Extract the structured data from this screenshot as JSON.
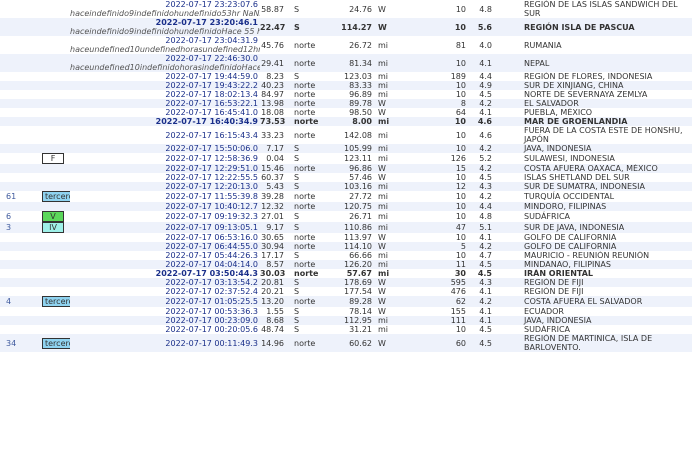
{
  "rows": [
    {
      "felt": "",
      "intensity": "",
      "time": "2022-07-17 23:23:07.6",
      "sub": "haceindefinido9indefinidohundefinido53hr NaNmin ago",
      "dist": "58.87",
      "dir": "S",
      "dist2": "24.76",
      "unit": "W",
      "depth": "10",
      "mag": "4.8",
      "region": "REGIÓN DE LAS ISLAS SANDWICH DEL SUR",
      "alt": false,
      "bold": false
    },
    {
      "felt": "",
      "intensity": "",
      "time": "2022-07-17 23:20:46.1",
      "sub": "haceindefinido9indefinidohundefinidoHace 55 horas NaNmin",
      "dist": "22.47",
      "dir": "S",
      "dist2": "114.27",
      "unit": "W",
      "depth": "10",
      "mag": "5.6",
      "region": "REGIÓN ISLA DE PASCUA",
      "alt": true,
      "bold": true
    },
    {
      "felt": "",
      "intensity": "",
      "time": "2022-07-17 23:04:31.9",
      "sub": "haceundefined10undefinedhorasundefined12hr NaNmin ago",
      "dist": "45.76",
      "dir": "norte",
      "dist2": "26.72",
      "unit": "mi",
      "depth": "81",
      "mag": "4.0",
      "region": "RUMANIA",
      "alt": false,
      "bold": false
    },
    {
      "felt": "",
      "intensity": "",
      "time": "2022-07-17 22:46:30.0",
      "sub": "haceundefined10indefinidohorasindefinidoHace 30hr NaNmin",
      "dist": "29.41",
      "dir": "norte",
      "dist2": "81.34",
      "unit": "mi",
      "depth": "10",
      "mag": "4.1",
      "region": "NEPAL",
      "alt": true,
      "bold": false
    },
    {
      "felt": "",
      "intensity": "",
      "time": "2022-07-17 19:44:59.0",
      "sub": "",
      "dist": "8.23",
      "dir": "S",
      "dist2": "123.03",
      "unit": "mi",
      "depth": "189",
      "mag": "4.4",
      "region": "REGIÓN DE FLORES, INDONESIA",
      "alt": false,
      "bold": false
    },
    {
      "felt": "",
      "intensity": "",
      "time": "2022-07-17 19:43:22.2",
      "sub": "",
      "dist": "40.23",
      "dir": "norte",
      "dist2": "83.33",
      "unit": "mi",
      "depth": "10",
      "mag": "4.9",
      "region": "SUR DE XINJIANG, CHINA",
      "alt": true,
      "bold": false
    },
    {
      "felt": "",
      "intensity": "",
      "time": "2022-07-17 18:02:13.4",
      "sub": "",
      "dist": "84.97",
      "dir": "norte",
      "dist2": "96.89",
      "unit": "mi",
      "depth": "10",
      "mag": "4.5",
      "region": "NORTE DE SEVERNAYA ZEMLYA",
      "alt": false,
      "bold": false
    },
    {
      "felt": "",
      "intensity": "",
      "time": "2022-07-17 16:53:22.1",
      "sub": "",
      "dist": "13.98",
      "dir": "norte",
      "dist2": "89.78",
      "unit": "W",
      "depth": "8",
      "mag": "4.2",
      "region": "EL SALVADOR",
      "alt": true,
      "bold": false
    },
    {
      "felt": "",
      "intensity": "",
      "time": "2022-07-17 16:45:41.0",
      "sub": "",
      "dist": "18.08",
      "dir": "norte",
      "dist2": "98.50",
      "unit": "W",
      "depth": "64",
      "mag": "4.1",
      "region": "PUEBLA, MÉXICO",
      "alt": false,
      "bold": false
    },
    {
      "felt": "",
      "intensity": "",
      "time": "2022-07-17 16:40:34.9",
      "sub": "",
      "dist": "73.53",
      "dir": "norte",
      "dist2": "8.00",
      "unit": "mi",
      "depth": "10",
      "mag": "4.6",
      "region": "MAR DE GROENLANDIA",
      "alt": true,
      "bold": true
    },
    {
      "felt": "",
      "intensity": "",
      "time": "2022-07-17 16:15:43.4",
      "sub": "",
      "dist": "33.23",
      "dir": "norte",
      "dist2": "142.08",
      "unit": "mi",
      "depth": "10",
      "mag": "4.6",
      "region": "FUERA DE LA COSTA ESTE DE HONSHU, JAPÓN",
      "alt": false,
      "bold": false
    },
    {
      "felt": "",
      "intensity": "",
      "time": "2022-07-17 15:50:06.0",
      "sub": "",
      "dist": "7.17",
      "dir": "S",
      "dist2": "105.99",
      "unit": "mi",
      "depth": "10",
      "mag": "4.2",
      "region": "JAVA, INDONESIA",
      "alt": true,
      "bold": false
    },
    {
      "felt": "",
      "intensity": "F",
      "time": "2022-07-17 12:58:36.9",
      "sub": "",
      "dist": "0.04",
      "dir": "S",
      "dist2": "123.11",
      "unit": "mi",
      "depth": "126",
      "mag": "5.2",
      "region": "SULAWESI, INDONESIA",
      "alt": false,
      "bold": false
    },
    {
      "felt": "",
      "intensity": "",
      "time": "2022-07-17 12:29:51.0",
      "sub": "",
      "dist": "15.46",
      "dir": "norte",
      "dist2": "96.86",
      "unit": "W",
      "depth": "15",
      "mag": "4.2",
      "region": "COSTA AFUERA OAXACA, MÉXICO",
      "alt": true,
      "bold": false
    },
    {
      "felt": "",
      "intensity": "",
      "time": "2022-07-17 12:22:55.5",
      "sub": "",
      "dist": "60.37",
      "dir": "S",
      "dist2": "57.46",
      "unit": "W",
      "depth": "10",
      "mag": "4.5",
      "region": "ISLAS SHETLAND DEL SUR",
      "alt": false,
      "bold": false
    },
    {
      "felt": "",
      "intensity": "",
      "time": "2022-07-17 12:20:13.0",
      "sub": "",
      "dist": "5.43",
      "dir": "S",
      "dist2": "103.16",
      "unit": "mi",
      "depth": "12",
      "mag": "4.3",
      "region": "SUR DE SUMATRA, INDONESIA",
      "alt": true,
      "bold": false
    },
    {
      "felt": "61",
      "intensity": "tercero",
      "time": "2022-07-17 11:55:39.8",
      "sub": "",
      "dist": "39.28",
      "dir": "norte",
      "dist2": "27.72",
      "unit": "mi",
      "depth": "10",
      "mag": "4.2",
      "region": "TURQUÍA OCCIDENTAL",
      "alt": false,
      "bold": false
    },
    {
      "felt": "",
      "intensity": "",
      "time": "2022-07-17 10:40:12.7",
      "sub": "",
      "dist": "12.32",
      "dir": "norte",
      "dist2": "120.75",
      "unit": "mi",
      "depth": "10",
      "mag": "4.4",
      "region": "MINDORO, FILIPINAS",
      "alt": true,
      "bold": false
    },
    {
      "felt": "6",
      "intensity": "V",
      "time": "2022-07-17 09:19:32.3",
      "sub": "",
      "dist": "27.01",
      "dir": "S",
      "dist2": "26.71",
      "unit": "mi",
      "depth": "10",
      "mag": "4.8",
      "region": "SUDÁFRICA",
      "alt": false,
      "bold": false
    },
    {
      "felt": "3",
      "intensity": "IV",
      "time": "2022-07-17 09:13:05.1",
      "sub": "",
      "dist": "9.17",
      "dir": "S",
      "dist2": "110.86",
      "unit": "mi",
      "depth": "47",
      "mag": "5.1",
      "region": "SUR DE JAVA, INDONESIA",
      "alt": true,
      "bold": false
    },
    {
      "felt": "",
      "intensity": "",
      "time": "2022-07-17 06:53:16.0",
      "sub": "",
      "dist": "30.65",
      "dir": "norte",
      "dist2": "113.97",
      "unit": "W",
      "depth": "10",
      "mag": "4.1",
      "region": "GOLFO DE CALIFORNIA",
      "alt": false,
      "bold": false
    },
    {
      "felt": "",
      "intensity": "",
      "time": "2022-07-17 06:44:55.0",
      "sub": "",
      "dist": "30.94",
      "dir": "norte",
      "dist2": "114.10",
      "unit": "W",
      "depth": "5",
      "mag": "4.2",
      "region": "GOLFO DE CALIFORNIA",
      "alt": true,
      "bold": false
    },
    {
      "felt": "",
      "intensity": "",
      "time": "2022-07-17 05:44:26.3",
      "sub": "",
      "dist": "17.17",
      "dir": "S",
      "dist2": "66.66",
      "unit": "mi",
      "depth": "10",
      "mag": "4.7",
      "region": "MAURICIO - REUNIÓN REUNIÓN",
      "alt": false,
      "bold": false
    },
    {
      "felt": "",
      "intensity": "",
      "time": "2022-07-17 04:04:14.0",
      "sub": "",
      "dist": "8.57",
      "dir": "norte",
      "dist2": "126.20",
      "unit": "mi",
      "depth": "11",
      "mag": "4.5",
      "region": "MINDANAO, FILIPINAS",
      "alt": true,
      "bold": false
    },
    {
      "felt": "",
      "intensity": "",
      "time": "2022-07-17 03:50:44.3",
      "sub": "",
      "dist": "30.03",
      "dir": "norte",
      "dist2": "57.67",
      "unit": "mi",
      "depth": "30",
      "mag": "4.5",
      "region": "IRÁN ORIENTAL",
      "alt": false,
      "bold": true
    },
    {
      "felt": "",
      "intensity": "",
      "time": "2022-07-17 03:13:54.2",
      "sub": "",
      "dist": "20.81",
      "dir": "S",
      "dist2": "178.69",
      "unit": "W",
      "depth": "595",
      "mag": "4.3",
      "region": "REGIÓN DE FIJI",
      "alt": true,
      "bold": false
    },
    {
      "felt": "",
      "intensity": "",
      "time": "2022-07-17 02:37:52.4",
      "sub": "",
      "dist": "20.21",
      "dir": "S",
      "dist2": "177.54",
      "unit": "W",
      "depth": "476",
      "mag": "4.1",
      "region": "REGIÓN DE FIJI",
      "alt": false,
      "bold": false
    },
    {
      "felt": "4",
      "intensity": "tercero",
      "time": "2022-07-17 01:05:25.5",
      "sub": "",
      "dist": "13.20",
      "dir": "norte",
      "dist2": "89.28",
      "unit": "W",
      "depth": "62",
      "mag": "4.2",
      "region": "COSTA AFUERA EL SALVADOR",
      "alt": true,
      "bold": false
    },
    {
      "felt": "",
      "intensity": "",
      "time": "2022-07-17 00:53:36.3",
      "sub": "",
      "dist": "1.55",
      "dir": "S",
      "dist2": "78.14",
      "unit": "W",
      "depth": "155",
      "mag": "4.1",
      "region": "ECUADOR",
      "alt": false,
      "bold": false
    },
    {
      "felt": "",
      "intensity": "",
      "time": "2022-07-17 00:23:09.0",
      "sub": "",
      "dist": "8.68",
      "dir": "S",
      "dist2": "112.95",
      "unit": "mi",
      "depth": "111",
      "mag": "4.1",
      "region": "JAVA, INDONESIA",
      "alt": true,
      "bold": false
    },
    {
      "felt": "",
      "intensity": "",
      "time": "2022-07-17 00:20:05.6",
      "sub": "",
      "dist": "48.74",
      "dir": "S",
      "dist2": "31.21",
      "unit": "mi",
      "depth": "10",
      "mag": "4.5",
      "region": "SUDÁFRICA",
      "alt": false,
      "bold": false
    },
    {
      "felt": "34",
      "intensity": "tercero",
      "time": "2022-07-17 00:11:49.3",
      "sub": "",
      "dist": "14.96",
      "dir": "norte",
      "dist2": "60.62",
      "unit": "W",
      "depth": "60",
      "mag": "4.5",
      "region": "REGIÓN DE MARTINICA, ISLA DE BARLOVENTO.",
      "alt": true,
      "bold": false
    }
  ]
}
